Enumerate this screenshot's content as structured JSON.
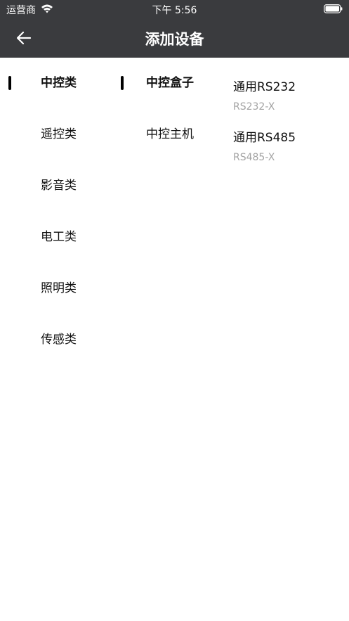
{
  "status_bar": {
    "carrier": "运营商",
    "time": "下午 5:56"
  },
  "nav": {
    "title": "添加设备"
  },
  "categories": [
    {
      "label": "中控类",
      "active": true
    },
    {
      "label": "遥控类",
      "active": false
    },
    {
      "label": "影音类",
      "active": false
    },
    {
      "label": "电工类",
      "active": false
    },
    {
      "label": "照明类",
      "active": false
    },
    {
      "label": "传感类",
      "active": false
    }
  ],
  "subtypes": [
    {
      "label": "中控盒子",
      "active": true
    },
    {
      "label": "中控主机",
      "active": false
    }
  ],
  "models": [
    {
      "name": "通用RS232",
      "code": "RS232-X"
    },
    {
      "name": "通用RS485",
      "code": "RS485-X"
    }
  ]
}
